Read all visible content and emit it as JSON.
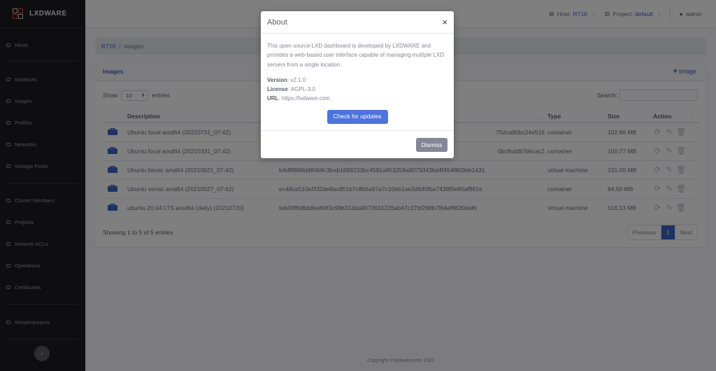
{
  "brand": {
    "name": "LXDWARE"
  },
  "sidebar": {
    "items": [
      {
        "label": "Hosts",
        "icon": "server-icon"
      },
      {
        "label": "Instances",
        "icon": "cube-icon"
      },
      {
        "label": "Images",
        "icon": "images-icon"
      },
      {
        "label": "Profiles",
        "icon": "profile-icon"
      },
      {
        "label": "Networks",
        "icon": "network-icon"
      },
      {
        "label": "Storage Pools",
        "icon": "database-icon"
      },
      {
        "label": "Cluster Members",
        "icon": "cluster-icon"
      },
      {
        "label": "Projects",
        "icon": "project-icon"
      },
      {
        "label": "Network ACLs",
        "icon": "shield-icon"
      },
      {
        "label": "Operations",
        "icon": "exchange-icon"
      },
      {
        "label": "Certificates",
        "icon": "certificate-icon"
      },
      {
        "label": "Simplestreams",
        "icon": "stream-icon"
      }
    ],
    "collapse_glyph": "‹"
  },
  "topbar": {
    "host_label": "Host:",
    "host_value": "R710",
    "project_label": "Project:",
    "project_value": "default",
    "user": "admin",
    "chevron": "›"
  },
  "breadcrumb": {
    "root": "R710",
    "separator": "/",
    "current": "images"
  },
  "card": {
    "title": "Images",
    "add_label": "Image",
    "show_label": "Show",
    "entries_select": "10",
    "entries_label": "entries",
    "search_label": "Search:"
  },
  "table": {
    "headers": [
      "",
      "Description",
      "",
      "Type",
      "Size",
      "Action"
    ],
    "rows": [
      {
        "description": "Ubuntu focal amd64 (20210731_07:42)",
        "fingerprint": "75dca85bc24e516",
        "type": "container",
        "size": "102.86 MB"
      },
      {
        "description": "Ubuntu focal amd64 (20210331_07:42)",
        "fingerprint": "0bcfbdd97b6cac2",
        "type": "container",
        "size": "100.77 MB"
      },
      {
        "description": "Ubuntu bionic amd64 (20210621_07:42)",
        "fingerprint": "b4df8888dd84b8c3bab1689233bc4591a953259a8079343bd4f454f803eb1431",
        "type": "virtual-machine",
        "size": "231.00 MB"
      },
      {
        "description": "Ubuntu xenial amd64 (20210527_07:42)",
        "fingerprint": "ec48ca510ef332de8ac851b7c8b5a97a7c10eb1ae3d640fba7438f0e80af981e",
        "type": "container",
        "size": "84.50 MB"
      },
      {
        "description": "ubuntu 20.04 LTS amd64 (daily) (20210720)",
        "fingerprint": "feb39ff0dbb8ee60f3c99b313da9072631226ab47c27bf296b7f64ef9820daf6",
        "type": "virtual-machine",
        "size": "516.13 MB"
      }
    ],
    "summary": "Showing 1 to 5 of 5 entries",
    "pager": {
      "previous": "Previous",
      "page": "1",
      "next": "Next"
    }
  },
  "footer": {
    "copyright": "Copyright © lxdware.com 2021"
  },
  "modal": {
    "title": "About",
    "close": "×",
    "description": "This open source LXD dashboard is developed by LXDWARE and provides a web-based user interface capable of managing multiple LXD servers from a single location.",
    "version_label": "Version",
    "version_value": ": v2.1.0",
    "license_label": "License",
    "license_value": ": AGPL-3.0",
    "url_label": "URL",
    "url_value": ": https://lxdware.com",
    "check_button": "Check for updates",
    "dismiss_button": "Dismiss"
  },
  "colors": {
    "accent": "#4e73df",
    "link": "#3d62c4",
    "sidebar": "#1d1d20",
    "dismiss": "#858796"
  }
}
